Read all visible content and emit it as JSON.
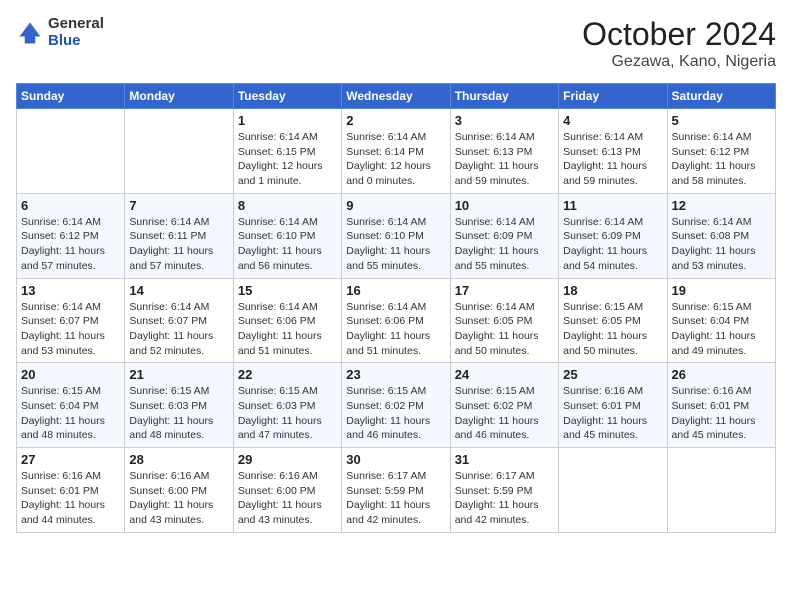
{
  "header": {
    "logo": {
      "general": "General",
      "blue": "Blue"
    },
    "title": "October 2024",
    "location": "Gezawa, Kano, Nigeria"
  },
  "weekdays": [
    "Sunday",
    "Monday",
    "Tuesday",
    "Wednesday",
    "Thursday",
    "Friday",
    "Saturday"
  ],
  "weeks": [
    [
      {
        "day": null
      },
      {
        "day": null
      },
      {
        "day": "1",
        "sunrise": "Sunrise: 6:14 AM",
        "sunset": "Sunset: 6:15 PM",
        "daylight": "Daylight: 12 hours and 1 minute."
      },
      {
        "day": "2",
        "sunrise": "Sunrise: 6:14 AM",
        "sunset": "Sunset: 6:14 PM",
        "daylight": "Daylight: 12 hours and 0 minutes."
      },
      {
        "day": "3",
        "sunrise": "Sunrise: 6:14 AM",
        "sunset": "Sunset: 6:13 PM",
        "daylight": "Daylight: 11 hours and 59 minutes."
      },
      {
        "day": "4",
        "sunrise": "Sunrise: 6:14 AM",
        "sunset": "Sunset: 6:13 PM",
        "daylight": "Daylight: 11 hours and 59 minutes."
      },
      {
        "day": "5",
        "sunrise": "Sunrise: 6:14 AM",
        "sunset": "Sunset: 6:12 PM",
        "daylight": "Daylight: 11 hours and 58 minutes."
      }
    ],
    [
      {
        "day": "6",
        "sunrise": "Sunrise: 6:14 AM",
        "sunset": "Sunset: 6:12 PM",
        "daylight": "Daylight: 11 hours and 57 minutes."
      },
      {
        "day": "7",
        "sunrise": "Sunrise: 6:14 AM",
        "sunset": "Sunset: 6:11 PM",
        "daylight": "Daylight: 11 hours and 57 minutes."
      },
      {
        "day": "8",
        "sunrise": "Sunrise: 6:14 AM",
        "sunset": "Sunset: 6:10 PM",
        "daylight": "Daylight: 11 hours and 56 minutes."
      },
      {
        "day": "9",
        "sunrise": "Sunrise: 6:14 AM",
        "sunset": "Sunset: 6:10 PM",
        "daylight": "Daylight: 11 hours and 55 minutes."
      },
      {
        "day": "10",
        "sunrise": "Sunrise: 6:14 AM",
        "sunset": "Sunset: 6:09 PM",
        "daylight": "Daylight: 11 hours and 55 minutes."
      },
      {
        "day": "11",
        "sunrise": "Sunrise: 6:14 AM",
        "sunset": "Sunset: 6:09 PM",
        "daylight": "Daylight: 11 hours and 54 minutes."
      },
      {
        "day": "12",
        "sunrise": "Sunrise: 6:14 AM",
        "sunset": "Sunset: 6:08 PM",
        "daylight": "Daylight: 11 hours and 53 minutes."
      }
    ],
    [
      {
        "day": "13",
        "sunrise": "Sunrise: 6:14 AM",
        "sunset": "Sunset: 6:07 PM",
        "daylight": "Daylight: 11 hours and 53 minutes."
      },
      {
        "day": "14",
        "sunrise": "Sunrise: 6:14 AM",
        "sunset": "Sunset: 6:07 PM",
        "daylight": "Daylight: 11 hours and 52 minutes."
      },
      {
        "day": "15",
        "sunrise": "Sunrise: 6:14 AM",
        "sunset": "Sunset: 6:06 PM",
        "daylight": "Daylight: 11 hours and 51 minutes."
      },
      {
        "day": "16",
        "sunrise": "Sunrise: 6:14 AM",
        "sunset": "Sunset: 6:06 PM",
        "daylight": "Daylight: 11 hours and 51 minutes."
      },
      {
        "day": "17",
        "sunrise": "Sunrise: 6:14 AM",
        "sunset": "Sunset: 6:05 PM",
        "daylight": "Daylight: 11 hours and 50 minutes."
      },
      {
        "day": "18",
        "sunrise": "Sunrise: 6:15 AM",
        "sunset": "Sunset: 6:05 PM",
        "daylight": "Daylight: 11 hours and 50 minutes."
      },
      {
        "day": "19",
        "sunrise": "Sunrise: 6:15 AM",
        "sunset": "Sunset: 6:04 PM",
        "daylight": "Daylight: 11 hours and 49 minutes."
      }
    ],
    [
      {
        "day": "20",
        "sunrise": "Sunrise: 6:15 AM",
        "sunset": "Sunset: 6:04 PM",
        "daylight": "Daylight: 11 hours and 48 minutes."
      },
      {
        "day": "21",
        "sunrise": "Sunrise: 6:15 AM",
        "sunset": "Sunset: 6:03 PM",
        "daylight": "Daylight: 11 hours and 48 minutes."
      },
      {
        "day": "22",
        "sunrise": "Sunrise: 6:15 AM",
        "sunset": "Sunset: 6:03 PM",
        "daylight": "Daylight: 11 hours and 47 minutes."
      },
      {
        "day": "23",
        "sunrise": "Sunrise: 6:15 AM",
        "sunset": "Sunset: 6:02 PM",
        "daylight": "Daylight: 11 hours and 46 minutes."
      },
      {
        "day": "24",
        "sunrise": "Sunrise: 6:15 AM",
        "sunset": "Sunset: 6:02 PM",
        "daylight": "Daylight: 11 hours and 46 minutes."
      },
      {
        "day": "25",
        "sunrise": "Sunrise: 6:16 AM",
        "sunset": "Sunset: 6:01 PM",
        "daylight": "Daylight: 11 hours and 45 minutes."
      },
      {
        "day": "26",
        "sunrise": "Sunrise: 6:16 AM",
        "sunset": "Sunset: 6:01 PM",
        "daylight": "Daylight: 11 hours and 45 minutes."
      }
    ],
    [
      {
        "day": "27",
        "sunrise": "Sunrise: 6:16 AM",
        "sunset": "Sunset: 6:01 PM",
        "daylight": "Daylight: 11 hours and 44 minutes."
      },
      {
        "day": "28",
        "sunrise": "Sunrise: 6:16 AM",
        "sunset": "Sunset: 6:00 PM",
        "daylight": "Daylight: 11 hours and 43 minutes."
      },
      {
        "day": "29",
        "sunrise": "Sunrise: 6:16 AM",
        "sunset": "Sunset: 6:00 PM",
        "daylight": "Daylight: 11 hours and 43 minutes."
      },
      {
        "day": "30",
        "sunrise": "Sunrise: 6:17 AM",
        "sunset": "Sunset: 5:59 PM",
        "daylight": "Daylight: 11 hours and 42 minutes."
      },
      {
        "day": "31",
        "sunrise": "Sunrise: 6:17 AM",
        "sunset": "Sunset: 5:59 PM",
        "daylight": "Daylight: 11 hours and 42 minutes."
      },
      {
        "day": null
      },
      {
        "day": null
      }
    ]
  ]
}
